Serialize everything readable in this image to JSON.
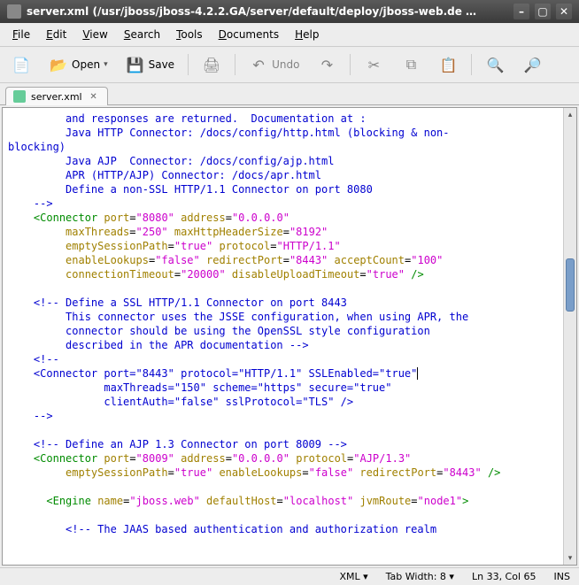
{
  "window": {
    "title": "server.xml (/usr/jboss/jboss-4.2.2.GA/server/default/deploy/jboss-web.de …"
  },
  "menubar": {
    "file": "File",
    "edit": "Edit",
    "view": "View",
    "search": "Search",
    "tools": "Tools",
    "documents": "Documents",
    "help": "Help"
  },
  "toolbar": {
    "open": "Open",
    "save": "Save",
    "undo": "Undo"
  },
  "tabs": [
    {
      "label": "server.xml"
    }
  ],
  "code": {
    "l1": "         and responses are returned.  Documentation at :",
    "l2": "         Java HTTP Connector: /docs/config/http.html (blocking & non-",
    "l3": "blocking)",
    "l4": "         Java AJP  Connector: /docs/config/ajp.html",
    "l5": "         APR (HTTP/AJP) Connector: /docs/apr.html",
    "l6": "         Define a non-SSL HTTP/1.1 Connector on port 8080",
    "l7": "    -->",
    "l8_tag": "Connector",
    "l8_a1": "port",
    "l8_v1": "\"8080\"",
    "l8_a2": "address",
    "l8_v2": "\"0.0.0.0\"",
    "l9_a1": "maxThreads",
    "l9_v1": "\"250\"",
    "l9_a2": "maxHttpHeaderSize",
    "l9_v2": "\"8192\"",
    "l10_a1": "emptySessionPath",
    "l10_v1": "\"true\"",
    "l10_a2": "protocol",
    "l10_v2": "\"HTTP/1.1\"",
    "l11_a1": "enableLookups",
    "l11_v1": "\"false\"",
    "l11_a2": "redirectPort",
    "l11_v2": "\"8443\"",
    "l11_a3": "acceptCount",
    "l11_v3": "\"100\"",
    "l12_a1": "connectionTimeout",
    "l12_v1": "\"20000\"",
    "l12_a2": "disableUploadTimeout",
    "l12_v2": "\"true\"",
    "l14": "    <!-- Define a SSL HTTP/1.1 Connector on port 8443",
    "l15": "         This connector uses the JSSE configuration, when using APR, the ",
    "l16": "         connector should be using the OpenSSL style configuration",
    "l17": "         described in the APR documentation -->",
    "l18": "    <!--",
    "l19": "    <Connector port=\"8443\" protocol=\"HTTP/1.1\" SSLEnabled=\"true\"",
    "l20": "               maxThreads=\"150\" scheme=\"https\" secure=\"true\"",
    "l21": "               clientAuth=\"false\" sslProtocol=\"TLS\" />",
    "l22": "    -->",
    "l24": "    <!-- Define an AJP 1.3 Connector on port 8009 -->",
    "l25_tag": "Connector",
    "l25_a1": "port",
    "l25_v1": "\"8009\"",
    "l25_a2": "address",
    "l25_v2": "\"0.0.0.0\"",
    "l25_a3": "protocol",
    "l25_v3": "\"AJP/1.3\"",
    "l26_a1": "emptySessionPath",
    "l26_v1": "\"true\"",
    "l26_a2": "enableLookups",
    "l26_v2": "\"false\"",
    "l26_a3": "redirectPort",
    "l26_v3": "\"8443\"",
    "l28_tag": "Engine",
    "l28_a1": "name",
    "l28_v1": "\"jboss.web\"",
    "l28_a2": "defaultHost",
    "l28_v2": "\"localhost\"",
    "l28_a3": "jvmRoute",
    "l28_v3": "\"node1\"",
    "l30": "         <!-- The JAAS based authentication and authorization realm "
  },
  "statusbar": {
    "lang": "XML",
    "tabwidth": "Tab Width: 8",
    "pos": "Ln 33, Col 65",
    "ins": "INS"
  }
}
